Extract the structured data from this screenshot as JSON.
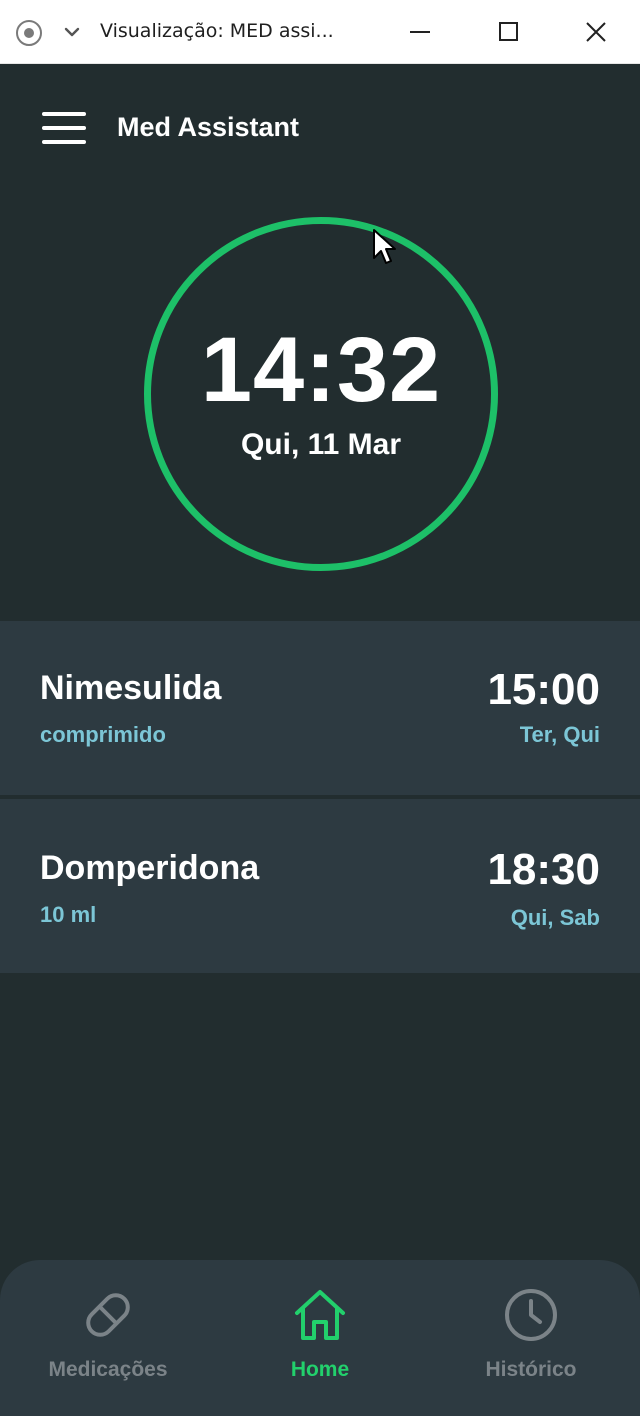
{
  "window": {
    "title": "Visualização: MED assi..."
  },
  "header": {
    "app_title": "Med Assistant",
    "menu_icon": "hamburger-menu-icon"
  },
  "clock": {
    "time": "14:32",
    "date": "Qui, 11 Mar",
    "ring_color": "#1dc068"
  },
  "medications": [
    {
      "name": "Nimesulida",
      "dose": "comprimido",
      "time": "15:00",
      "days": "Ter, Qui"
    },
    {
      "name": "Domperidona",
      "dose": "10 ml",
      "time": "18:30",
      "days": "Qui, Sab"
    }
  ],
  "bottom_nav": {
    "items": [
      {
        "label": "Medicações",
        "icon": "pill-icon",
        "active": false
      },
      {
        "label": "Home",
        "icon": "home-icon",
        "active": true
      },
      {
        "label": "Histórico",
        "icon": "clock-icon",
        "active": false
      }
    ],
    "active_color": "#22d06c",
    "inactive_color": "#7b8388"
  },
  "colors": {
    "background": "#222d2f",
    "card": "#2d3a41",
    "accent": "#1dc068",
    "secondary_text": "#7cc6d6"
  }
}
